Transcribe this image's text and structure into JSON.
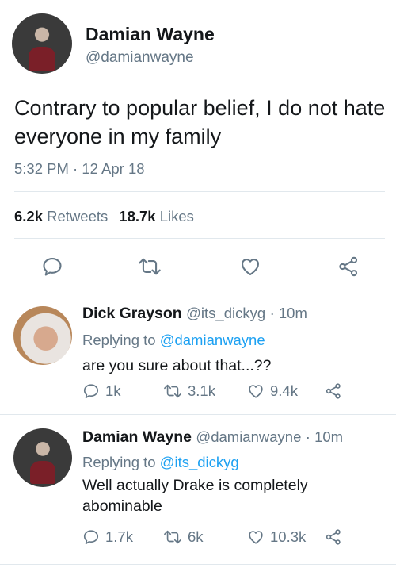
{
  "main_tweet": {
    "author_name": "Damian Wayne",
    "author_handle": "@damianwayne",
    "text": "Contrary to popular belief, I do not hate everyone in my family",
    "timestamp": "5:32 PM · 12 Apr 18",
    "retweets_count": "6.2k",
    "retweets_label": "Retweets",
    "likes_count": "18.7k",
    "likes_label": "Likes",
    "actions": [
      "reply-icon",
      "retweet-icon",
      "heart-icon",
      "share-icon"
    ]
  },
  "replies": [
    {
      "author_name": "Dick Grayson",
      "author_handle": "@its_dickyg",
      "time": "· 10m",
      "replying_to_label": "Replying to",
      "replying_to_handle": "@damianwayne",
      "text": "are you sure about that...??",
      "reply_count": "1k",
      "retweet_count": "3.1k",
      "like_count": "9.4k"
    },
    {
      "author_name": "Damian Wayne",
      "author_handle": "@damianwayne",
      "time": "· 10m",
      "replying_to_label": "Replying to",
      "replying_to_handle": "@its_dickyg",
      "text": "Well actually Drake is completely abominable",
      "reply_count": "1.7k",
      "retweet_count": "6k",
      "like_count": "10.3k"
    }
  ],
  "colors": {
    "text": "#14171a",
    "secondary": "#657786",
    "accent": "#1da1f2",
    "divider": "#e1e8ed"
  }
}
